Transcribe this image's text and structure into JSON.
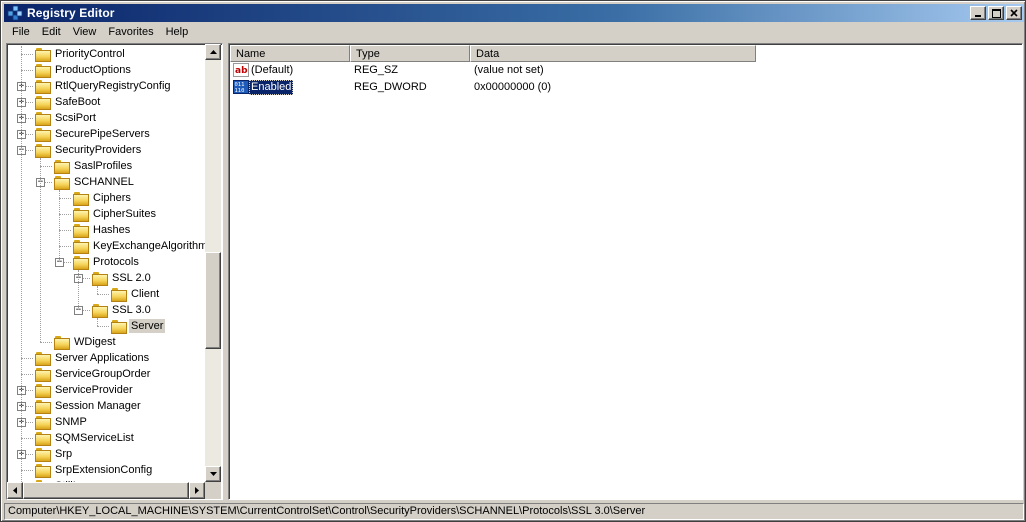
{
  "window": {
    "title": "Registry Editor"
  },
  "menu": [
    "File",
    "Edit",
    "View",
    "Favorites",
    "Help"
  ],
  "tree": [
    {
      "label": "PriorityControl",
      "level": 0,
      "expander": "",
      "selected": false
    },
    {
      "label": "ProductOptions",
      "level": 0,
      "expander": "",
      "selected": false
    },
    {
      "label": "RtlQueryRegistryConfig",
      "level": 0,
      "expander": "+",
      "selected": false
    },
    {
      "label": "SafeBoot",
      "level": 0,
      "expander": "+",
      "selected": false
    },
    {
      "label": "ScsiPort",
      "level": 0,
      "expander": "+",
      "selected": false
    },
    {
      "label": "SecurePipeServers",
      "level": 0,
      "expander": "+",
      "selected": false
    },
    {
      "label": "SecurityProviders",
      "level": 0,
      "expander": "-",
      "selected": false
    },
    {
      "label": "SaslProfiles",
      "level": 1,
      "expander": "",
      "selected": false
    },
    {
      "label": "SCHANNEL",
      "level": 1,
      "expander": "-",
      "selected": false
    },
    {
      "label": "Ciphers",
      "level": 2,
      "expander": "",
      "selected": false
    },
    {
      "label": "CipherSuites",
      "level": 2,
      "expander": "",
      "selected": false
    },
    {
      "label": "Hashes",
      "level": 2,
      "expander": "",
      "selected": false
    },
    {
      "label": "KeyExchangeAlgorithms",
      "level": 2,
      "expander": "",
      "selected": false
    },
    {
      "label": "Protocols",
      "level": 2,
      "expander": "-",
      "selected": false
    },
    {
      "label": "SSL 2.0",
      "level": 3,
      "expander": "-",
      "selected": false
    },
    {
      "label": "Client",
      "level": 4,
      "expander": "",
      "selected": false
    },
    {
      "label": "SSL 3.0",
      "level": 3,
      "expander": "-",
      "selected": false
    },
    {
      "label": "Server",
      "level": 4,
      "expander": "",
      "selected": true
    },
    {
      "label": "WDigest",
      "level": 1,
      "expander": "",
      "selected": false
    },
    {
      "label": "Server Applications",
      "level": 0,
      "expander": "",
      "selected": false
    },
    {
      "label": "ServiceGroupOrder",
      "level": 0,
      "expander": "",
      "selected": false
    },
    {
      "label": "ServiceProvider",
      "level": 0,
      "expander": "+",
      "selected": false
    },
    {
      "label": "Session Manager",
      "level": 0,
      "expander": "+",
      "selected": false
    },
    {
      "label": "SNMP",
      "level": 0,
      "expander": "+",
      "selected": false
    },
    {
      "label": "SQMServiceList",
      "level": 0,
      "expander": "",
      "selected": false
    },
    {
      "label": "Srp",
      "level": 0,
      "expander": "+",
      "selected": false
    },
    {
      "label": "SrpExtensionConfig",
      "level": 0,
      "expander": "",
      "selected": false
    },
    {
      "label": "StillImage",
      "level": 0,
      "expander": "+",
      "selected": false
    }
  ],
  "list": {
    "columns": [
      "Name",
      "Type",
      "Data"
    ],
    "rows": [
      {
        "name": "(Default)",
        "type": "REG_SZ",
        "data": "(value not set)",
        "icon": "string-value-icon",
        "selected": false
      },
      {
        "name": "Enabled",
        "type": "REG_DWORD",
        "data": "0x00000000 (0)",
        "icon": "binary-value-icon",
        "selected": true
      }
    ]
  },
  "status": "Computer\\HKEY_LOCAL_MACHINE\\SYSTEM\\CurrentControlSet\\Control\\SecurityProviders\\SCHANNEL\\Protocols\\SSL 3.0\\Server",
  "scroll": {
    "vertical_position_fraction": 0.62,
    "visible_fraction": 0.24
  },
  "colors": {
    "title_start": "#0a246a",
    "title_end": "#a6caf0",
    "selection": "#0a246a",
    "face": "#d4d0c8"
  }
}
